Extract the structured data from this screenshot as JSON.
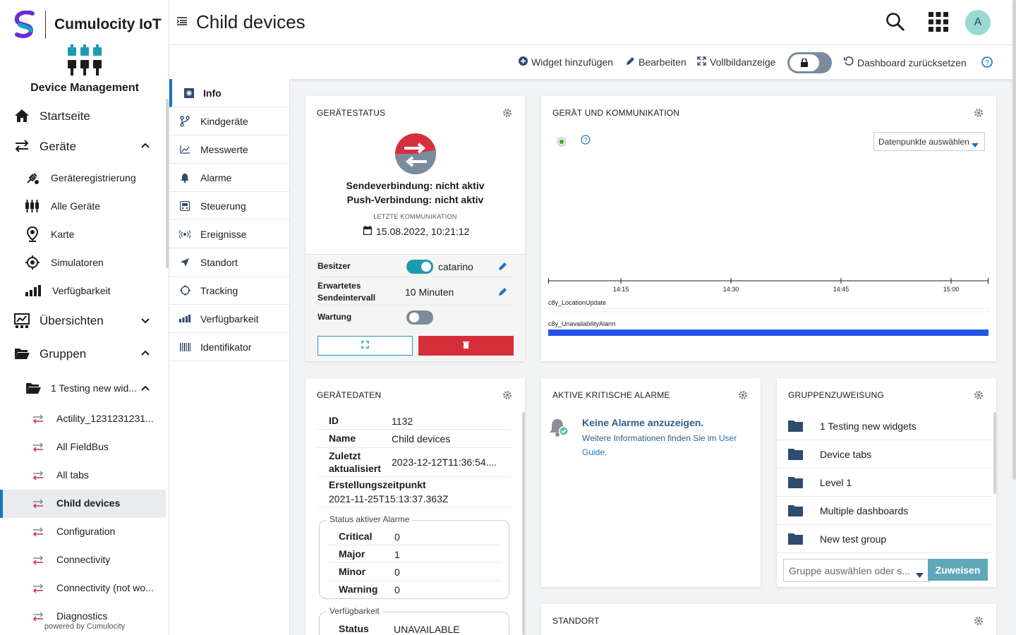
{
  "brand": {
    "name": "Cumulocity IoT",
    "app": "Device Management",
    "powered": "powered by Cumulocity"
  },
  "nav": {
    "home": "Startseite",
    "devices": "Geräte",
    "registration": "Geräteregistrierung",
    "all_devices": "Alle Geräte",
    "map": "Karte",
    "simulators": "Simulatoren",
    "availability": "Verfügbarkeit",
    "overviews": "Übersichten",
    "groups": "Gruppen",
    "group_open": "1 Testing new wid...",
    "sub_items": [
      "Actility_1231231231...",
      "All FieldBus",
      "All tabs",
      "Child devices",
      "Configuration",
      "Connectivity",
      "Connectivity (not wo...",
      "Diagnostics"
    ]
  },
  "header": {
    "title": "Child devices",
    "avatar": "A"
  },
  "toolbar": {
    "add_widget": "Widget hinzufügen",
    "edit": "Bearbeiten",
    "fullscreen": "Vollbildanzeige",
    "reset": "Dashboard zurücksetzen"
  },
  "tabs": [
    "Info",
    "Kindgeräte",
    "Messwerte",
    "Alarme",
    "Steuerung",
    "Ereignisse",
    "Standort",
    "Tracking",
    "Verfügbarkeit",
    "Identifikator"
  ],
  "device_status": {
    "title": "GERÄTESTATUS",
    "send": "Sendeverbindung: nicht aktiv",
    "push": "Push-Verbindung: nicht aktiv",
    "last_comm_label": "LETZTE KOMMUNIKATION",
    "last_comm": "15.08.2022, 10:21:12",
    "owner_label": "Besitzer",
    "owner": "catarino",
    "interval_label_1": "Erwartetes",
    "interval_label_2": "Sendeintervall",
    "interval": "10 Minuten",
    "maintenance_label": "Wartung"
  },
  "comm": {
    "title": "GERÄT UND KOMMUNIKATION",
    "select": "Datenpunkte auswählen",
    "ticks": [
      "14:15",
      "14:30",
      "14:45",
      "15:00"
    ],
    "series": [
      "c8y_LocationUpdate",
      "c8y_UnavailabilityAlarm"
    ]
  },
  "device_data": {
    "title": "GERÄTEDATEN",
    "id_label": "ID",
    "id": "1132",
    "name_label": "Name",
    "name": "Child devices",
    "updated_label_1": "Zuletzt",
    "updated_label_2": "aktualisiert",
    "updated": "2023-12-12T11:36:54....",
    "created_label": "Erstellungszeitpunkt",
    "created": "2021-11-25T15:13:37.363Z",
    "alarm_status_legend": "Status aktiver Alarme",
    "alarms": [
      {
        "k": "Critical",
        "v": "0"
      },
      {
        "k": "Major",
        "v": "1"
      },
      {
        "k": "Minor",
        "v": "0"
      },
      {
        "k": "Warning",
        "v": "0"
      }
    ],
    "avail_legend": "Verfügbarkeit",
    "status_label": "Status",
    "status": "UNAVAILABLE"
  },
  "alarms_card": {
    "title": "AKTIVE KRITISCHE ALARME",
    "none": "Keine Alarme anzuzeigen.",
    "info_pre": "Weitere Informationen finden Sie im ",
    "link1": "User",
    "link2": "Guide."
  },
  "groups_card": {
    "title": "GRUPPENZUWEISUNG",
    "items": [
      "1 Testing new widgets",
      "Device tabs",
      "Level 1",
      "Multiple dashboards",
      "New test group"
    ],
    "placeholder": "Gruppe auswählen oder s...",
    "assign": "Zuweisen"
  },
  "location_card": {
    "title": "STANDORT"
  },
  "colors": {
    "accent": "#1776bf",
    "teal": "#1a9cb0",
    "red": "#d62f3c",
    "navy": "#2f4b6e"
  }
}
